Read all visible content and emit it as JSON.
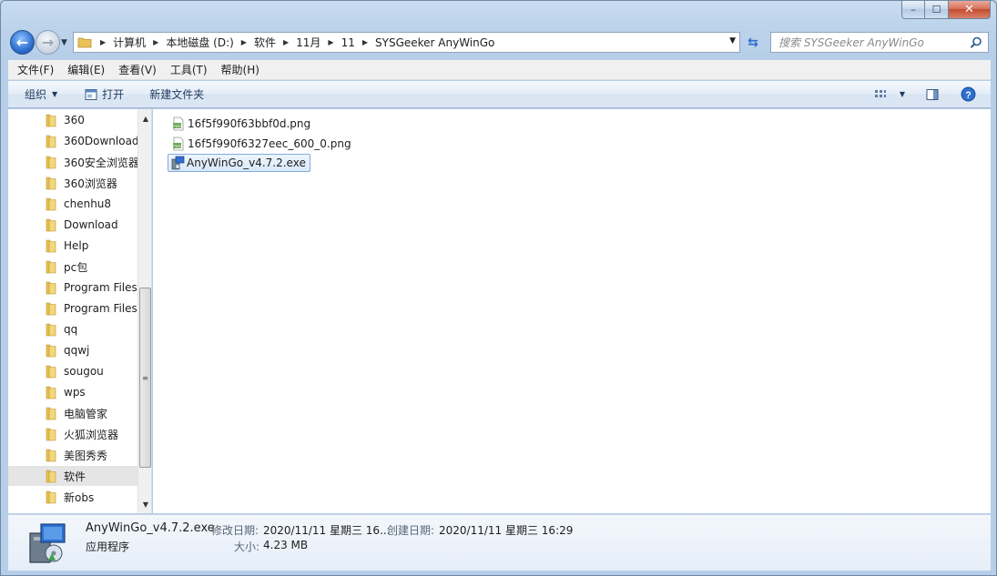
{
  "window": {
    "caption": {
      "minimize": "–",
      "maximize": "☐",
      "close": "✕"
    }
  },
  "address": {
    "breadcrumbs": [
      "计算机",
      "本地磁盘 (D:)",
      "软件",
      "11月",
      "11",
      "SYSGeeker AnyWinGo"
    ],
    "search_placeholder": "搜索 SYSGeeker AnyWinGo"
  },
  "menu": [
    "文件(F)",
    "编辑(E)",
    "查看(V)",
    "工具(T)",
    "帮助(H)"
  ],
  "commands": {
    "organize": "组织",
    "open": "打开",
    "new_folder": "新建文件夹"
  },
  "nav_pane": {
    "items": [
      "360",
      "360Download",
      "360安全浏览器",
      "360浏览器",
      "chenhu8",
      "Download",
      "Help",
      "pc包",
      "Program Files",
      "Program Files",
      "qq",
      "qqwj",
      "sougou",
      "wps",
      "电脑管家",
      "火狐浏览器",
      "美图秀秀",
      "软件",
      "新obs"
    ],
    "selected_index": 17
  },
  "files": [
    {
      "name": "16f5f990f63bbf0d.png",
      "type": "png"
    },
    {
      "name": "16f5f990f6327eec_600_0.png",
      "type": "png"
    },
    {
      "name": "AnyWinGo_v4.7.2.exe",
      "type": "exe",
      "selected": true
    }
  ],
  "details": {
    "name": "AnyWinGo_v4.7.2.exe",
    "type": "应用程序",
    "modified_label": "修改日期:",
    "modified_value": "2020/11/11 星期三 16...",
    "created_label": "创建日期:",
    "created_value": "2020/11/11 星期三 16:29",
    "size_label": "大小:",
    "size_value": "4.23 MB"
  },
  "colors": {
    "folder": "#e8c255",
    "selection_border": "#84acdd",
    "accent": "#2e6fcf"
  }
}
